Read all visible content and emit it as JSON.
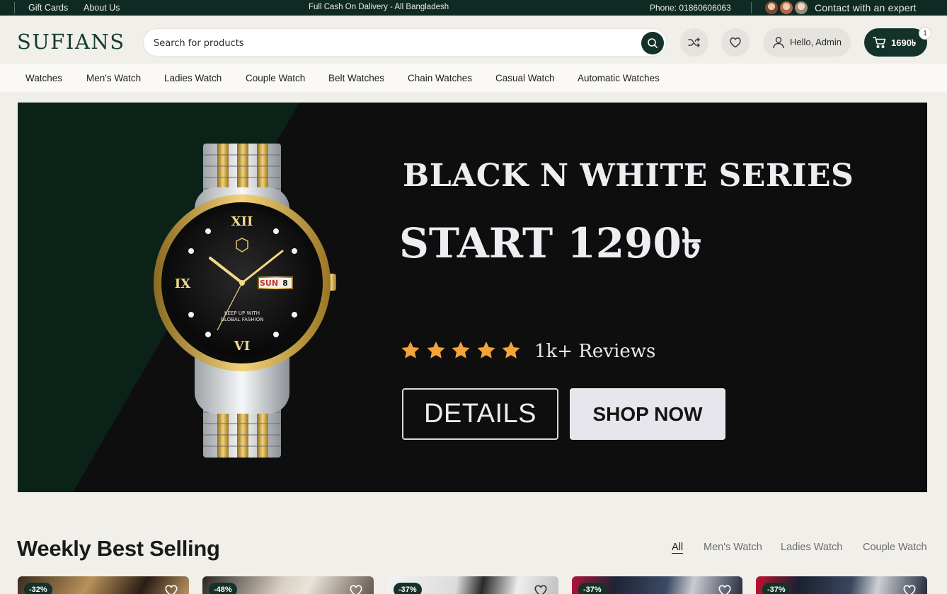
{
  "topbar": {
    "links": [
      "Gift Cards",
      "About Us"
    ],
    "announcement": "Full Cash On Dalivery - All Bangladesh",
    "phone": "Phone: 01860606063",
    "contact": "Contact with an expert"
  },
  "header": {
    "logo": "SUFIANS",
    "search_placeholder": "Search for products",
    "account_label": "Hello, Admin",
    "cart_total": "1690৳",
    "cart_count": "1"
  },
  "nav": {
    "categories": [
      "Watches",
      "Men's Watch",
      "Ladies Watch",
      "Couple Watch",
      "Belt Watches",
      "Chain Watches",
      "Casual Watch",
      "Automatic Watches"
    ]
  },
  "hero": {
    "title": "BLACK N WHITE SERIES",
    "price": "START 1290৳",
    "rating_stars": 5,
    "reviews": "1k+ Reviews",
    "details_label": "DETAILS",
    "shop_label": "SHOP NOW",
    "watch_date_day": "SUN",
    "watch_date_num": "8",
    "watch_dial_text_1": "KEEP UP WITH",
    "watch_dial_text_2": "GLOBAL FASHION"
  },
  "weekly": {
    "title": "Weekly Best Selling",
    "tabs": [
      "All",
      "Men's Watch",
      "Ladies Watch",
      "Couple Watch"
    ],
    "active_tab": "All",
    "products": [
      {
        "discount": "-32%"
      },
      {
        "discount": "-48%"
      },
      {
        "discount": "-37%"
      },
      {
        "discount": "-37%"
      },
      {
        "discount": "-37%"
      }
    ]
  },
  "colors": {
    "brand_dark_green": "#133229",
    "topbar_bg": "#0f2a22",
    "page_bg": "#f1efea",
    "hero_bg": "#0e0e0e",
    "star_orange": "#f4a23a"
  }
}
